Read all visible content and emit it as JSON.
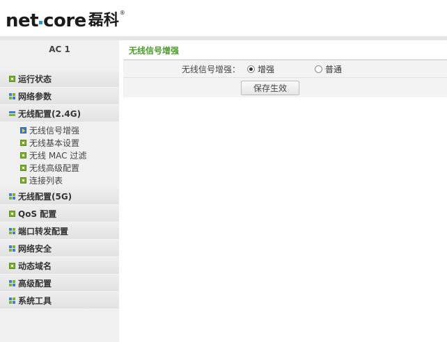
{
  "brand": {
    "logo_left": "net",
    "logo_right": "core",
    "logo_cn": "磊科",
    "registered": "®"
  },
  "sidebar": {
    "device_title": "AC 1",
    "items": [
      {
        "label": "运行状态",
        "icon": "square-icon"
      },
      {
        "label": "网络参数",
        "icon": "grid-icon"
      },
      {
        "label": "无线配置(2.4G)",
        "icon": "expanded-bars-icon",
        "expanded": true,
        "children": [
          {
            "label": "无线信号增强",
            "icon": "arrow-icon",
            "active": true
          },
          {
            "label": "无线基本设置",
            "icon": "square-icon"
          },
          {
            "label": "无线 MAC 过滤",
            "icon": "square-icon"
          },
          {
            "label": "无线高级配置",
            "icon": "square-icon"
          },
          {
            "label": "连接列表",
            "icon": "square-icon"
          }
        ]
      },
      {
        "label": "无线配置(5G)",
        "icon": "grid-icon"
      },
      {
        "label": "QoS 配置",
        "icon": "square-icon"
      },
      {
        "label": "端口转发配置",
        "icon": "grid-icon"
      },
      {
        "label": "网络安全",
        "icon": "grid-icon"
      },
      {
        "label": "动态域名",
        "icon": "square-icon"
      },
      {
        "label": "高级配置",
        "icon": "grid-icon"
      },
      {
        "label": "系统工具",
        "icon": "grid-icon"
      }
    ]
  },
  "main": {
    "section_title": "无线信号增强",
    "field_label": "无线信号增强：",
    "options": [
      {
        "label": "增强",
        "selected": true
      },
      {
        "label": "普通",
        "selected": false
      }
    ],
    "save_button": "保存生效"
  },
  "colors": {
    "accent_green": "#4f9a2f",
    "icon_green": "#7bb030",
    "icon_blue": "#3f7fc9",
    "logo_dot_blue": "#2a93d4"
  }
}
